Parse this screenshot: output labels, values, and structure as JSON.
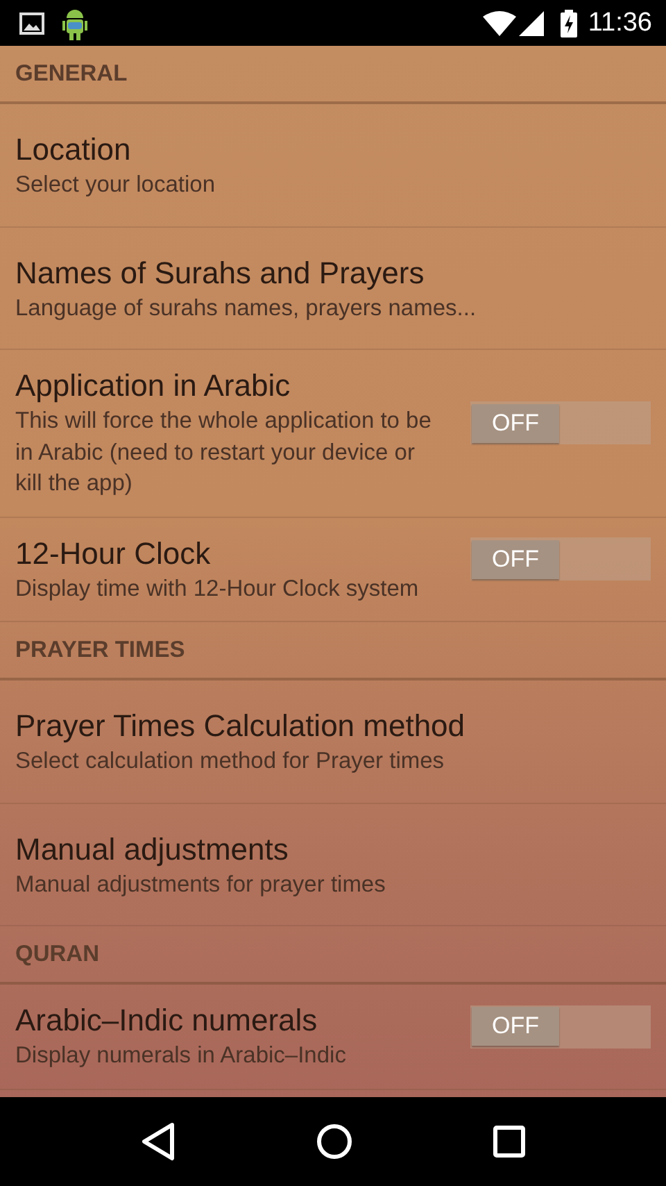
{
  "status_bar": {
    "time": "11:36"
  },
  "preferences": [
    {
      "kind": "header",
      "title": "GENERAL"
    },
    {
      "kind": "item",
      "title": "Location",
      "summary": "Select your location"
    },
    {
      "kind": "item",
      "title": "Names of Surahs and Prayers",
      "summary": "Language of surahs names, prayers names..."
    },
    {
      "kind": "toggle",
      "title": "Application in Arabic",
      "summary": "This will force the whole application to be in Arabic (need to restart your device or kill the app)",
      "switch": {
        "on": false,
        "label": "OFF"
      }
    },
    {
      "kind": "toggle",
      "title": "12-Hour Clock",
      "summary": "Display time with 12-Hour Clock system",
      "switch": {
        "on": false,
        "label": "OFF"
      }
    },
    {
      "kind": "header",
      "title": "PRAYER TIMES"
    },
    {
      "kind": "item",
      "title": "Prayer Times Calculation method",
      "summary": "Select calculation method for Prayer times"
    },
    {
      "kind": "item",
      "title": "Manual adjustments",
      "summary": "Manual adjustments for prayer times"
    },
    {
      "kind": "header",
      "title": "QURAN"
    },
    {
      "kind": "toggle",
      "title": "Arabic–Indic numerals",
      "summary": "Display numerals in Arabic–Indic",
      "switch": {
        "on": false,
        "label": "OFF"
      }
    }
  ]
}
